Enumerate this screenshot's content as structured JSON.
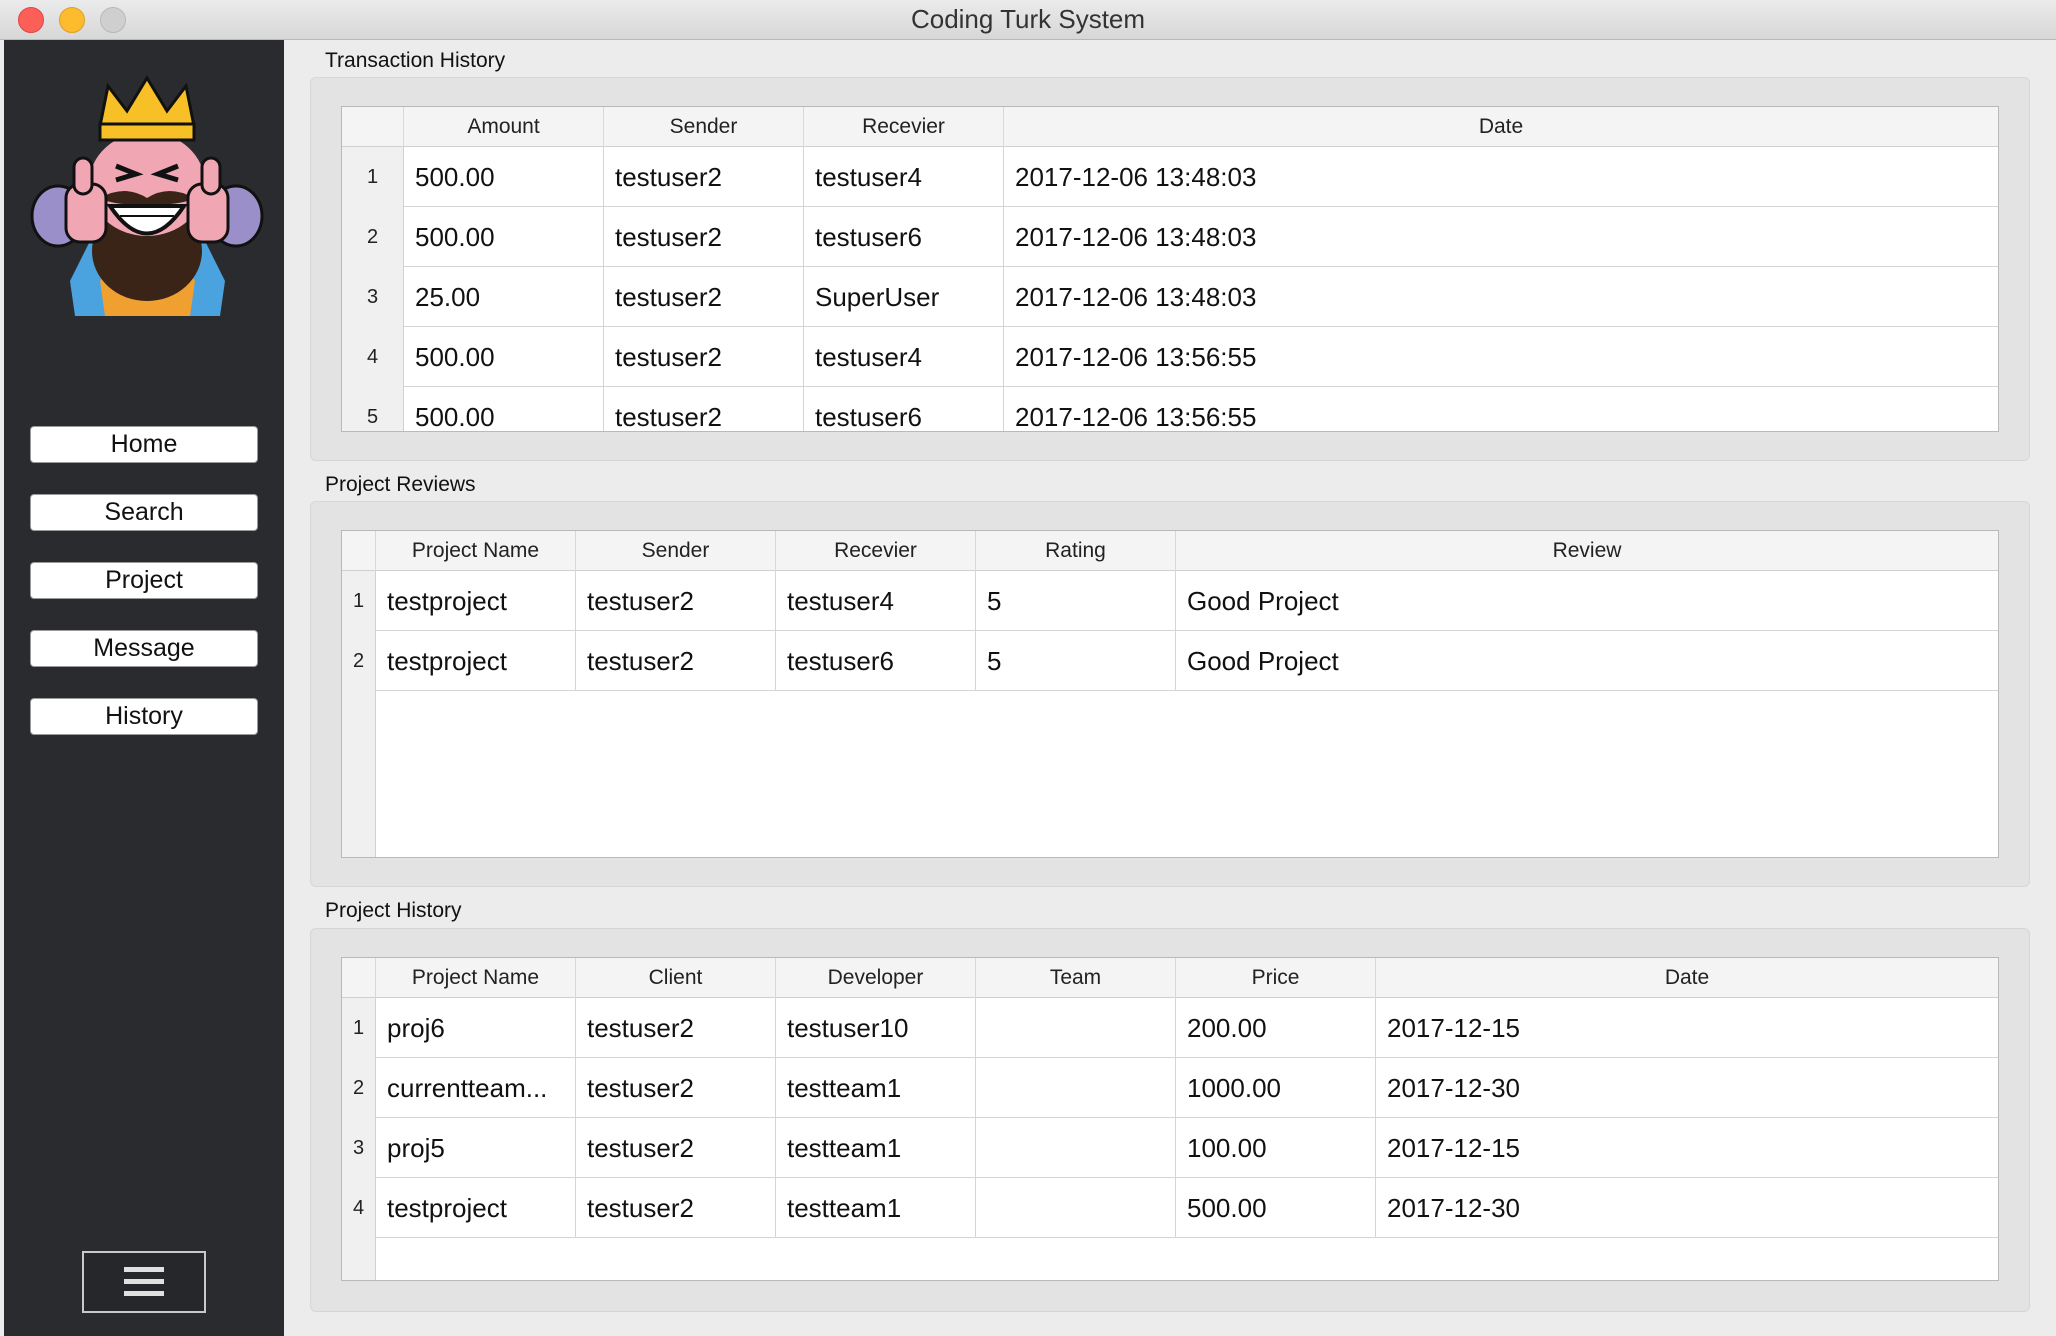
{
  "window": {
    "title": "Coding Turk System"
  },
  "sidebar": {
    "nav": [
      "Home",
      "Search",
      "Project",
      "Message",
      "History"
    ],
    "logo_icon": "crown-king-thumbs-up-logo",
    "menu_icon": "hamburger-menu-icon"
  },
  "transactions": {
    "title": "Transaction History",
    "headers": [
      "Amount",
      "Sender",
      "Recevier",
      "Date"
    ],
    "rows": [
      {
        "n": "1",
        "amount": "500.00",
        "sender": "testuser2",
        "receiver": "testuser4",
        "date": "2017-12-06 13:48:03"
      },
      {
        "n": "2",
        "amount": "500.00",
        "sender": "testuser2",
        "receiver": "testuser6",
        "date": "2017-12-06 13:48:03"
      },
      {
        "n": "3",
        "amount": "25.00",
        "sender": "testuser2",
        "receiver": "SuperUser",
        "date": "2017-12-06 13:48:03"
      },
      {
        "n": "4",
        "amount": "500.00",
        "sender": "testuser2",
        "receiver": "testuser4",
        "date": "2017-12-06 13:56:55"
      },
      {
        "n": "5",
        "amount": "500.00",
        "sender": "testuser2",
        "receiver": "testuser6",
        "date": "2017-12-06 13:56:55"
      }
    ]
  },
  "reviews": {
    "title": "Project Reviews",
    "headers": [
      "Project Name",
      "Sender",
      "Recevier",
      "Rating",
      "Review"
    ],
    "rows": [
      {
        "n": "1",
        "project": "testproject",
        "sender": "testuser2",
        "receiver": "testuser4",
        "rating": "5",
        "review": "Good Project"
      },
      {
        "n": "2",
        "project": "testproject",
        "sender": "testuser2",
        "receiver": "testuser6",
        "rating": "5",
        "review": "Good Project"
      }
    ]
  },
  "history": {
    "title": "Project History",
    "headers": [
      "Project Name",
      "Client",
      "Developer",
      "Team",
      "Price",
      "Date"
    ],
    "rows": [
      {
        "n": "1",
        "project": "proj6",
        "client": "testuser2",
        "developer": "testuser10",
        "team": "",
        "price": "200.00",
        "date": "2017-12-15"
      },
      {
        "n": "2",
        "project": "currentteam...",
        "client": "testuser2",
        "developer": "testteam1",
        "team": "",
        "price": "1000.00",
        "date": "2017-12-30"
      },
      {
        "n": "3",
        "project": "proj5",
        "client": "testuser2",
        "developer": "testteam1",
        "team": "",
        "price": "100.00",
        "date": "2017-12-15"
      },
      {
        "n": "4",
        "project": "testproject",
        "client": "testuser2",
        "developer": "testteam1",
        "team": "",
        "price": "500.00",
        "date": "2017-12-30"
      }
    ]
  }
}
